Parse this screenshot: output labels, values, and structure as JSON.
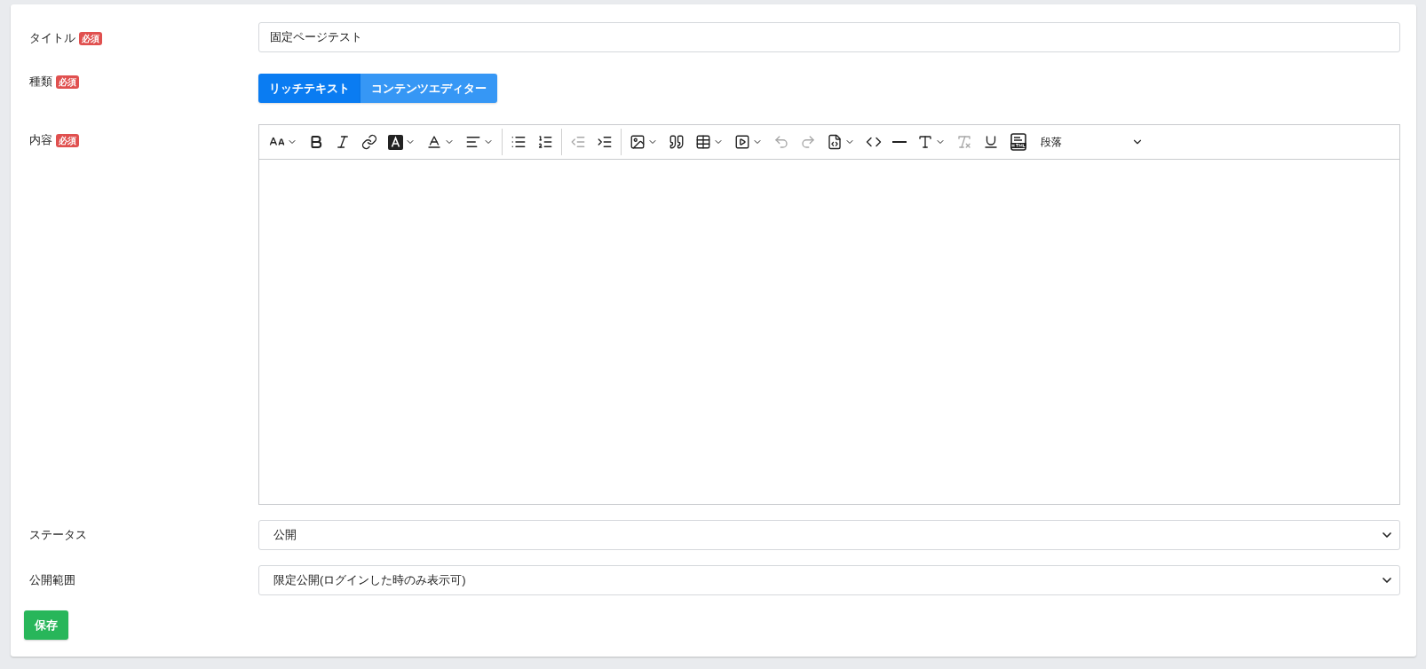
{
  "form": {
    "fields": [
      {
        "kind": "text",
        "label": "タイトル",
        "badge": "必須",
        "value": "固定ページテスト"
      },
      {
        "kind": "toggle",
        "label": "種類",
        "badge": "必須",
        "options": [
          {
            "label": "リッチテキスト",
            "selected": true
          },
          {
            "label": "コンテンツエディター",
            "selected": false
          }
        ]
      },
      {
        "kind": "editor",
        "label": "内容",
        "badge": "必須",
        "toolbar": [
          {
            "kind": "font-size",
            "dropdown": true,
            "disabled": false
          },
          {
            "kind": "bold",
            "dropdown": false,
            "disabled": false
          },
          {
            "kind": "italic",
            "dropdown": false,
            "disabled": false
          },
          {
            "kind": "link",
            "dropdown": false,
            "disabled": false
          },
          {
            "kind": "highlight",
            "dropdown": true,
            "disabled": false
          },
          {
            "kind": "font-color",
            "dropdown": true,
            "disabled": false
          },
          {
            "kind": "align",
            "dropdown": true,
            "disabled": false
          },
          {
            "kind": "separator"
          },
          {
            "kind": "bullet-list",
            "dropdown": false,
            "disabled": false
          },
          {
            "kind": "numbered-list",
            "dropdown": false,
            "disabled": false
          },
          {
            "kind": "separator"
          },
          {
            "kind": "outdent",
            "dropdown": false,
            "disabled": true
          },
          {
            "kind": "indent",
            "dropdown": false,
            "disabled": false
          },
          {
            "kind": "separator"
          },
          {
            "kind": "image",
            "dropdown": true,
            "disabled": false
          },
          {
            "kind": "quote",
            "dropdown": false,
            "disabled": false
          },
          {
            "kind": "table",
            "dropdown": true,
            "disabled": false
          },
          {
            "kind": "media",
            "dropdown": true,
            "disabled": false
          },
          {
            "kind": "undo",
            "dropdown": false,
            "disabled": true
          },
          {
            "kind": "redo",
            "dropdown": false,
            "disabled": true
          },
          {
            "kind": "source",
            "dropdown": true,
            "disabled": false
          },
          {
            "kind": "code",
            "dropdown": false,
            "disabled": false
          },
          {
            "kind": "horizontal-line",
            "dropdown": false,
            "disabled": false
          },
          {
            "kind": "font-style",
            "dropdown": true,
            "disabled": false
          },
          {
            "kind": "remove-format",
            "dropdown": false,
            "disabled": true
          },
          {
            "kind": "underline",
            "dropdown": false,
            "disabled": false
          },
          {
            "kind": "html-embed",
            "dropdown": false,
            "disabled": false
          },
          {
            "kind": "heading",
            "value": "段落"
          }
        ]
      },
      {
        "kind": "select",
        "label": "ステータス",
        "value": "公開"
      },
      {
        "kind": "select",
        "label": "公開範囲",
        "value": "限定公開(ログインした時のみ表示可)"
      }
    ],
    "save_button": "保存"
  }
}
